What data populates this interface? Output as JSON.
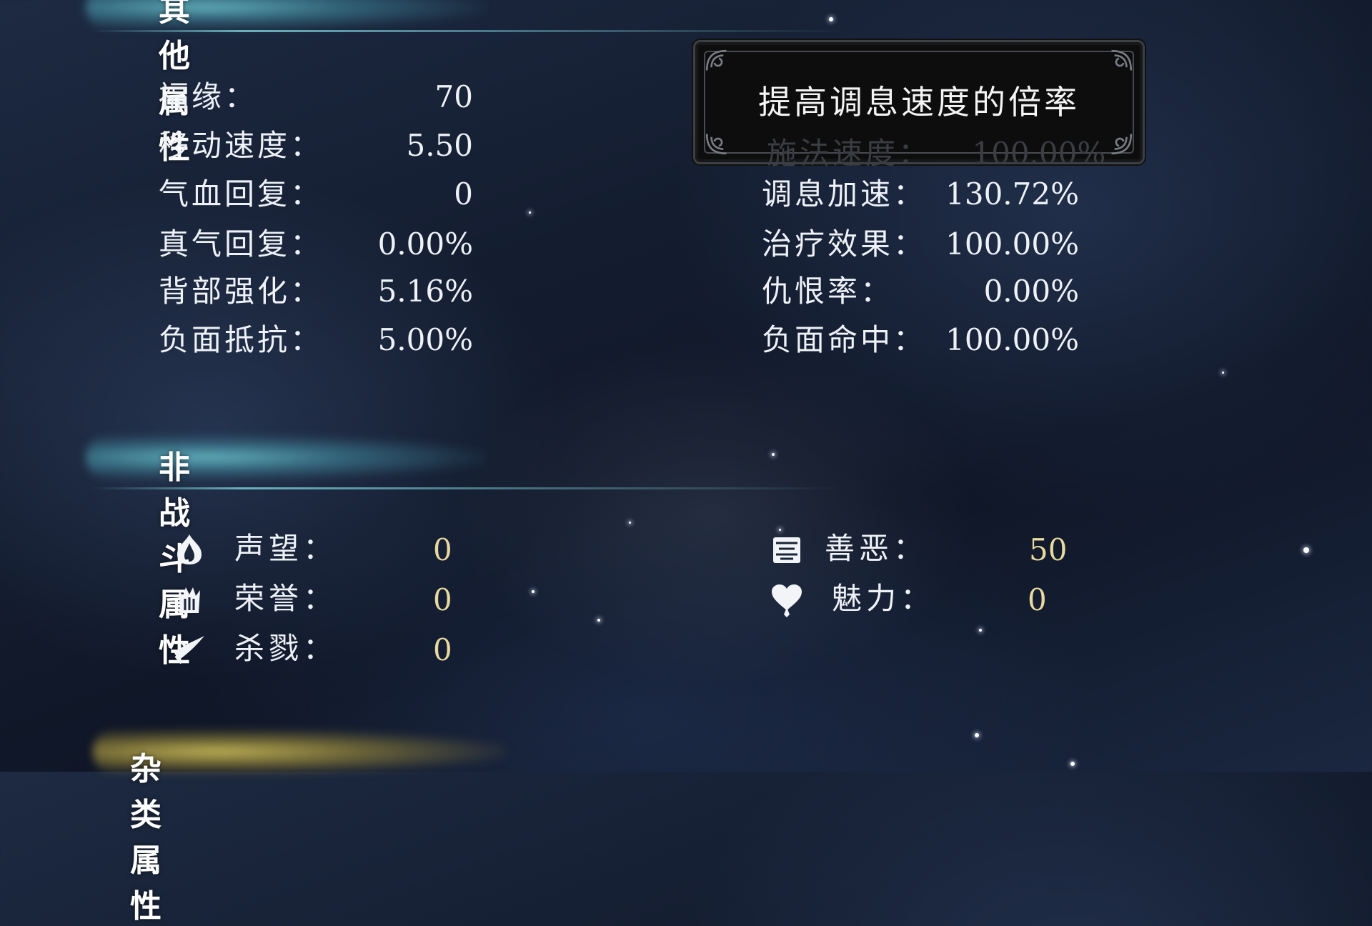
{
  "sections": {
    "special_title": "其他属性",
    "nonbattle_title": "非战斗属性",
    "third_title": "杂类属性"
  },
  "left_stats": [
    {
      "label": "福缘：",
      "value": "70"
    },
    {
      "label": "移动速度：",
      "value": "5.50"
    },
    {
      "label": "气血回复：",
      "value": "0"
    },
    {
      "label": "真气回复：",
      "value": "0.00%"
    },
    {
      "label": "背部强化：",
      "value": "5.16%"
    },
    {
      "label": "负面抵抗：",
      "value": "5.00%"
    }
  ],
  "right_stats": [
    {
      "label": "调息加速：",
      "value": "130.72%"
    },
    {
      "label": "治疗效果：",
      "value": "100.00%"
    },
    {
      "label": "仇恨率：",
      "value": "0.00%"
    },
    {
      "label": "负面命中：",
      "value": "100.00%"
    }
  ],
  "tooltip": {
    "text": "提高调息速度的倍率",
    "obscured_label": "施法速度：",
    "obscured_value": "100.00%"
  },
  "nonbattle": [
    {
      "icon": "flame-icon",
      "label": "声望：",
      "value": "0"
    },
    {
      "icon": "crown-icon",
      "label": "荣誉：",
      "value": "0"
    },
    {
      "icon": "blade-icon",
      "label": "杀戮：",
      "value": "0"
    },
    {
      "icon": "kindness-icon",
      "label": "善恶：",
      "value": "50"
    },
    {
      "icon": "heart-icon",
      "label": "魅力：",
      "value": "0"
    }
  ],
  "colors": {
    "background": "#141d30",
    "header_glow": "#6ec8d2",
    "value_gold": "#e8d9a0",
    "third_header_glow": "#d2c35a"
  }
}
